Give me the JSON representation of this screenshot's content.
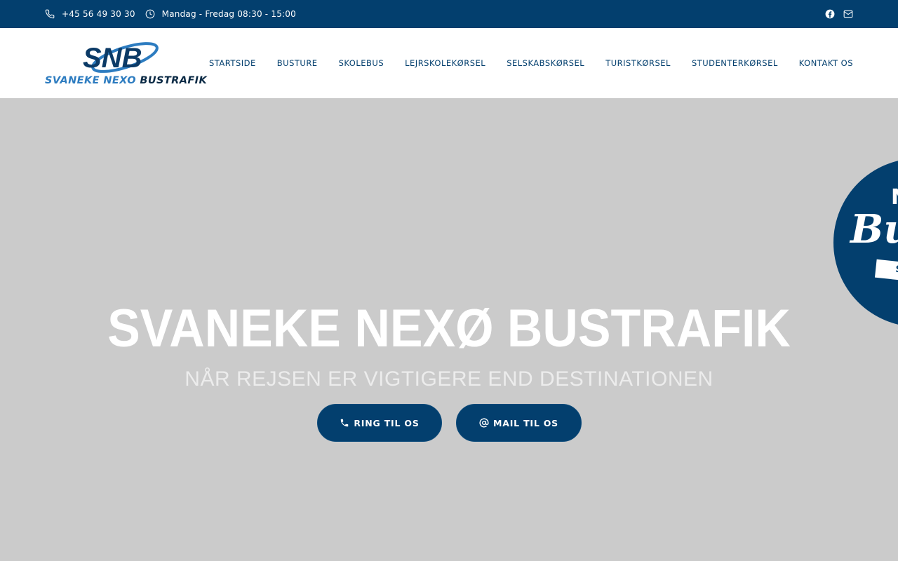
{
  "topbar": {
    "phone": "+45 56 49 30 30",
    "hours": "Mandag - Fredag 08:30 - 15:00",
    "icons": [
      "phone-icon",
      "clock-icon",
      "facebook-icon",
      "mail-icon"
    ]
  },
  "logo": {
    "mark": "SNB",
    "word_1": "SVANEKE NEXO",
    "word_2": "BUSTRAFIK"
  },
  "nav": {
    "items": [
      {
        "label": "STARTSIDE"
      },
      {
        "label": "BUSTURE"
      },
      {
        "label": "SKOLEBUS"
      },
      {
        "label": "LEJRSKOLEKØRSEL"
      },
      {
        "label": "SELSKABSKØRSEL"
      },
      {
        "label": "TURISTKØRSEL"
      },
      {
        "label": "STUDENTERKØRSEL"
      },
      {
        "label": "KONTAKT OS"
      }
    ]
  },
  "hero": {
    "title": "SVANEKE NEXØ BUSTRAFIK",
    "subtitle": "NÅR REJSEN ER VIGTIGERE END DESTINATIONEN",
    "call_label": "RING TIL OS",
    "mail_label": "MAIL TIL OS",
    "badge_line_1": "N",
    "badge_line_2": "Bu",
    "badge_line_3": "S"
  },
  "colors": {
    "primary": "#033f6e",
    "logo_blue": "#2d7cc0",
    "hero_bg": "#cbcbcb",
    "white": "#ffffff"
  }
}
